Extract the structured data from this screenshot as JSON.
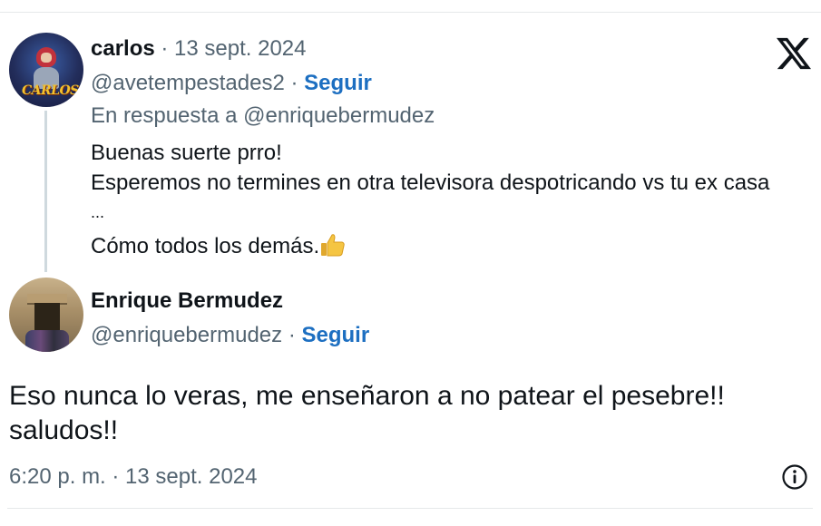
{
  "reply": {
    "author_name": "carlos",
    "date": " · 13 sept. 2024",
    "handle": "@avetempestades2",
    "separator": " · ",
    "follow_label": "Seguir",
    "in_reply_to": "En respuesta a @enriquebermudez",
    "avatar_text": "CARLOS",
    "lines": [
      "Buenas suerte prro!",
      "Esperemos no termines en otra televisora despotricando vs tu ex casa",
      "...",
      "Cómo todos los demás."
    ],
    "emoji": "thumbs-up"
  },
  "main_post": {
    "author_name": "Enrique Bermudez",
    "handle": "@enriquebermudez",
    "separator": " · ",
    "follow_label": "Seguir",
    "text_line_1": "Eso nunca lo veras, me enseñaron a no patear el pesebre!!",
    "text_line_2": "saludos!!",
    "timestamp": "6:20 p. m. · 13 sept. 2024"
  },
  "icons": {
    "platform_logo": "x-logo-icon",
    "info": "info-icon"
  },
  "colors": {
    "link_blue": "#1d6fc1",
    "muted_gray": "#536471",
    "text": "#0f1419",
    "thread_line": "#cfd9de"
  }
}
